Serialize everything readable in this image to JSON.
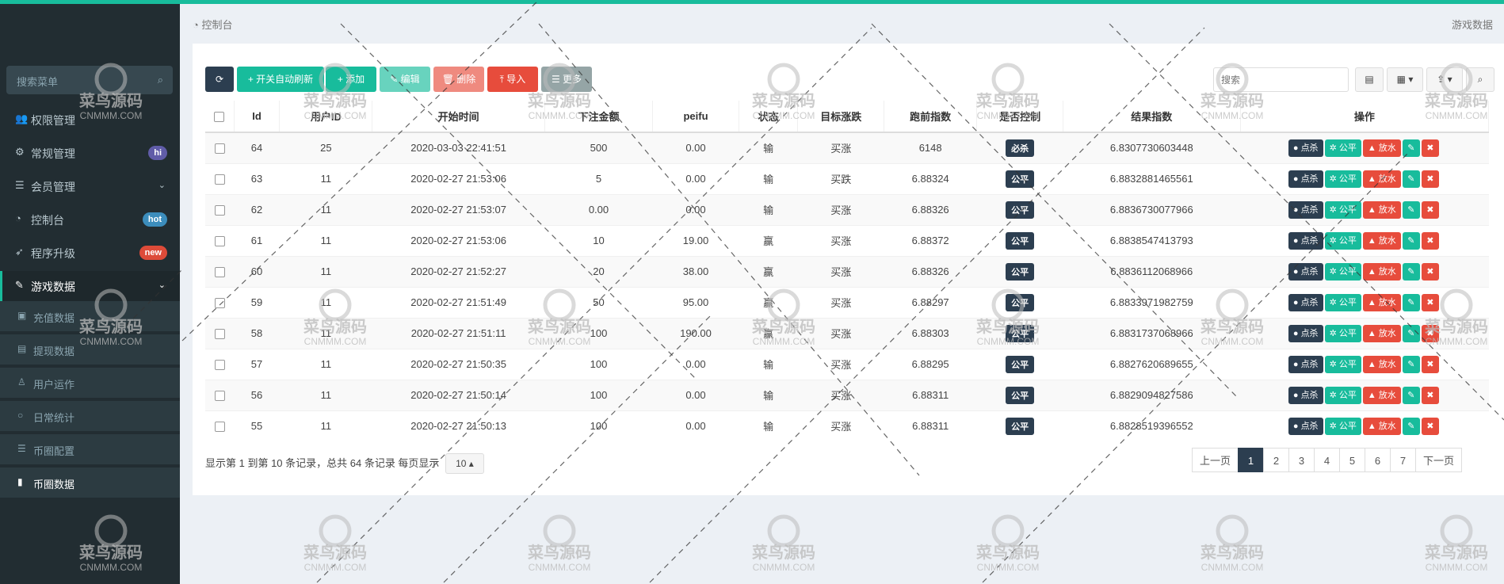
{
  "sidebar": {
    "search_placeholder": "搜索菜单",
    "items": [
      {
        "label": "权限管理",
        "icon": "users-icon"
      },
      {
        "label": "常规管理",
        "icon": "cogs-icon",
        "badge": "hi",
        "badge_color": "#605ca8"
      },
      {
        "label": "会员管理",
        "icon": "list-icon",
        "arrow": "⌄"
      },
      {
        "label": "控制台",
        "icon": "dashboard-icon",
        "badge": "hot",
        "badge_color": "#3c8dbc"
      },
      {
        "label": "程序升级",
        "icon": "rocket-icon",
        "badge": "new",
        "badge_color": "#dd4b39"
      },
      {
        "label": "游戏数据",
        "icon": "magic-icon",
        "arrow": "⌄"
      }
    ],
    "subitems": [
      {
        "label": "充值数据",
        "icon": "money-icon"
      },
      {
        "label": "提现数据",
        "icon": "wallet-icon"
      },
      {
        "label": "用户运作",
        "icon": "user-icon"
      },
      {
        "label": "日常统计",
        "icon": "circle-icon"
      },
      {
        "label": "币圈配置",
        "icon": "list-icon"
      },
      {
        "label": "币圈数据",
        "icon": "bar-chart-icon"
      }
    ]
  },
  "header": {
    "breadcrumb": "控制台",
    "right_label": "游戏数据"
  },
  "toolbar": {
    "refresh_label": "⟳",
    "auto_refresh_label": "+ 开关自动刷新",
    "add_label": "+ 添加",
    "edit_label": "✎ 编辑",
    "delete_label": "🗑 删除",
    "import_label": "⤒ 导入",
    "more_label": "☰ 更多",
    "search_placeholder": "搜索"
  },
  "table": {
    "columns": [
      "Id",
      "用户ID",
      "开始时间",
      "下注金额",
      "peifu",
      "状态",
      "目标涨跌",
      "跑前指数",
      "是否控制",
      "结果指数",
      "操作"
    ],
    "actions": {
      "kill": "点杀",
      "fair": "公平",
      "release": "放水"
    },
    "rows": [
      {
        "id": "64",
        "uid": "25",
        "time": "2020-03-03 22:41:51",
        "amount": "500",
        "peifu": "0.00",
        "status": "输",
        "target": "买涨",
        "before": "6148",
        "ctrl": "必杀",
        "result": "6.8307730603448"
      },
      {
        "id": "63",
        "uid": "11",
        "time": "2020-02-27 21:53:06",
        "amount": "5",
        "peifu": "0.00",
        "status": "输",
        "target": "买跌",
        "before": "6.88324",
        "ctrl": "公平",
        "result": "6.8832881465561"
      },
      {
        "id": "62",
        "uid": "11",
        "time": "2020-02-27 21:53:07",
        "amount": "0.00",
        "peifu": "0.00",
        "status": "输",
        "target": "买涨",
        "before": "6.88326",
        "ctrl": "公平",
        "result": "6.8836730077966"
      },
      {
        "id": "61",
        "uid": "11",
        "time": "2020-02-27 21:53:06",
        "amount": "10",
        "peifu": "19.00",
        "status": "赢",
        "target": "买涨",
        "before": "6.88372",
        "ctrl": "公平",
        "result": "6.8838547413793"
      },
      {
        "id": "60",
        "uid": "11",
        "time": "2020-02-27 21:52:27",
        "amount": "20",
        "peifu": "38.00",
        "status": "赢",
        "target": "买涨",
        "before": "6.88326",
        "ctrl": "公平",
        "result": "6.8836112068966"
      },
      {
        "id": "59",
        "uid": "11",
        "time": "2020-02-27 21:51:49",
        "amount": "50",
        "peifu": "95.00",
        "status": "赢",
        "target": "买涨",
        "before": "6.88297",
        "ctrl": "公平",
        "result": "6.8833971982759"
      },
      {
        "id": "58",
        "uid": "11",
        "time": "2020-02-27 21:51:11",
        "amount": "100",
        "peifu": "190.00",
        "status": "赢",
        "target": "买涨",
        "before": "6.88303",
        "ctrl": "公平",
        "result": "6.8831737068966"
      },
      {
        "id": "57",
        "uid": "11",
        "time": "2020-02-27 21:50:35",
        "amount": "100",
        "peifu": "0.00",
        "status": "输",
        "target": "买涨",
        "before": "6.88295",
        "ctrl": "公平",
        "result": "6.8827620689655"
      },
      {
        "id": "56",
        "uid": "11",
        "time": "2020-02-27 21:50:14",
        "amount": "100",
        "peifu": "0.00",
        "status": "输",
        "target": "买涨",
        "before": "6.88311",
        "ctrl": "公平",
        "result": "6.8829094827586"
      },
      {
        "id": "55",
        "uid": "11",
        "time": "2020-02-27 21:50:13",
        "amount": "100",
        "peifu": "0.00",
        "status": "输",
        "target": "买涨",
        "before": "6.88311",
        "ctrl": "公平",
        "result": "6.8828519396552"
      }
    ]
  },
  "footer": {
    "info": "显示第 1 到第 10 条记录，总共 64 条记录 每页显示",
    "page_size": "10 ▴",
    "prev": "上一页",
    "next": "下一页",
    "pages": [
      "1",
      "2",
      "3",
      "4",
      "5",
      "6",
      "7"
    ],
    "current_page": "1"
  },
  "watermark": {
    "title": "菜鸟源码",
    "url": "CNMMM.COM"
  }
}
